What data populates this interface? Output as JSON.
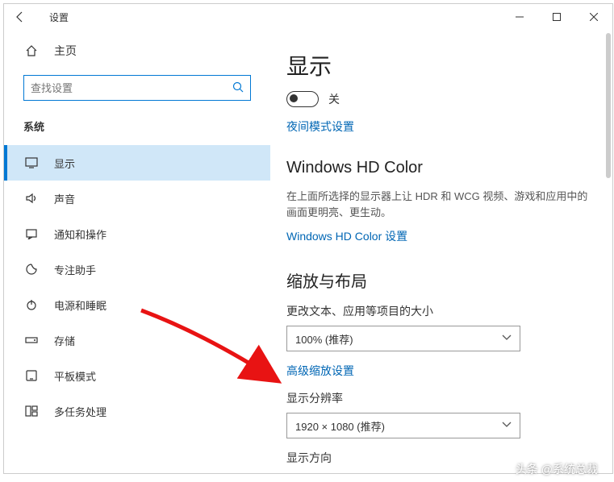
{
  "window": {
    "title": "设置"
  },
  "sidebar": {
    "home": "主页",
    "search_placeholder": "查找设置",
    "section": "系统",
    "items": [
      {
        "label": "显示"
      },
      {
        "label": "声音"
      },
      {
        "label": "通知和操作"
      },
      {
        "label": "专注助手"
      },
      {
        "label": "电源和睡眠"
      },
      {
        "label": "存储"
      },
      {
        "label": "平板模式"
      },
      {
        "label": "多任务处理"
      }
    ]
  },
  "main": {
    "heading": "显示",
    "toggle_state": "关",
    "night_link": "夜间模式设置",
    "hd_heading": "Windows HD Color",
    "hd_desc": "在上面所选择的显示器上让 HDR 和 WCG 视频、游戏和应用中的画面更明亮、更生动。",
    "hd_link": "Windows HD Color 设置",
    "scale_heading": "缩放与布局",
    "scale_label": "更改文本、应用等项目的大小",
    "scale_value": "100% (推荐)",
    "advanced_scale_link": "高级缩放设置",
    "resolution_label": "显示分辨率",
    "resolution_value": "1920 × 1080 (推荐)",
    "orientation_label": "显示方向"
  },
  "watermark": "头条 @系统总裁"
}
